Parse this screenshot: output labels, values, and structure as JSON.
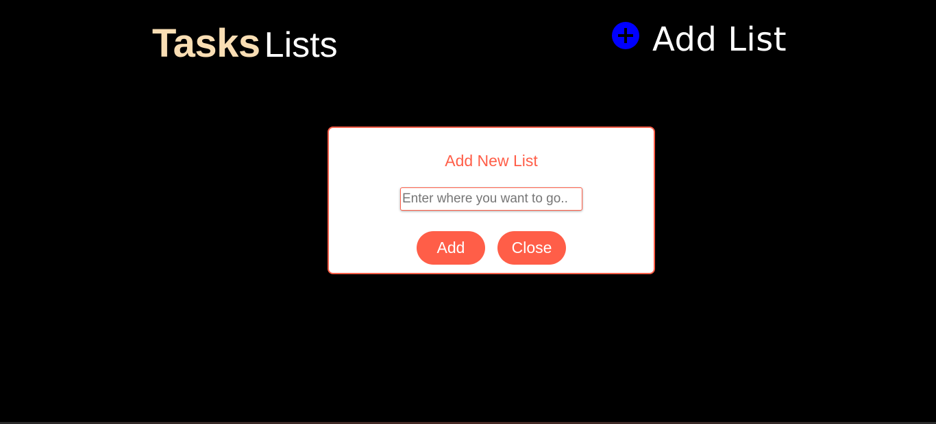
{
  "header": {
    "logo_bold": "Tasks",
    "logo_light": "Lists",
    "add_list_label": "Add List",
    "add_list_icon": "plus-circle-icon"
  },
  "modal": {
    "title": "Add New List",
    "input_placeholder": "Enter where you want to go..",
    "input_value": "",
    "add_button_label": "Add",
    "close_button_label": "Close"
  },
  "colors": {
    "background": "#000000",
    "logo_bold": "#f9deb4",
    "accent": "#ff5e48",
    "plus_icon": "#0000ff"
  }
}
